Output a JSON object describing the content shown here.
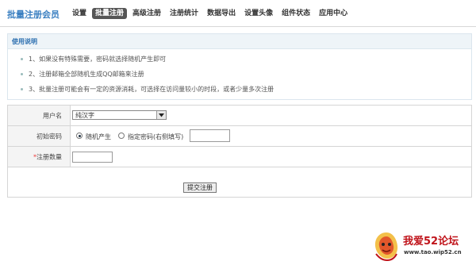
{
  "brand": "批量注册会员",
  "nav": [
    "设置",
    "批量注册",
    "高级注册",
    "注册统计",
    "数据导出",
    "设置头像",
    "组件状态",
    "应用中心"
  ],
  "usage": {
    "title": "使用说明",
    "tips": [
      "1、如果没有特殊需要，密码就选择随机产生即可",
      "2、注册邮箱全部随机生成QQ邮箱来注册",
      "3、批量注册可能会有一定的资源消耗，可选择在访问量较小的时段，或者少量多次注册"
    ]
  },
  "form": {
    "username_label": "用户名",
    "username_value": "纯汉字",
    "password_label": "初始密码",
    "password_random": "随机产生",
    "password_custom": "指定密码(右侧填写)",
    "count_required_mark": "*",
    "count_label": "注册数量",
    "submit": "提交注册"
  },
  "watermark": {
    "title": "我爱52论坛",
    "url": "www.tao.wip52.cn"
  },
  "colors": {
    "brand": "#3a7fc1",
    "active_tab": "#555555",
    "panel_header": "#eef4f8",
    "watermark_red": "#c0141b"
  }
}
